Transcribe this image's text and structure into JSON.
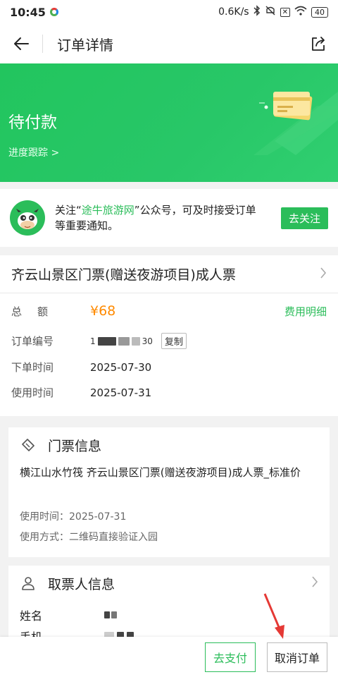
{
  "status_bar": {
    "time": "10:45",
    "network_speed": "0.6K/s",
    "battery": "40"
  },
  "header": {
    "title": "订单详情"
  },
  "banner": {
    "status": "待付款",
    "track_link": "进度跟踪 >",
    "bg_color": "#28c768"
  },
  "follow": {
    "text_before": "关注“",
    "brand": "途牛旅游网",
    "text_after": "”公众号，可及时接受订单等重要通知。",
    "button": "去关注"
  },
  "product": {
    "name": "齐云山景区门票(赠送夜游项目)成人票"
  },
  "order": {
    "total_label": "总额",
    "total_value": "¥68",
    "fee_detail": "费用明细",
    "number_label": "订单编号",
    "number_value_left": "1",
    "number_value_right": "30",
    "copy": "复制",
    "order_time_label": "下单时间",
    "order_time_value": "2025-07-30",
    "use_time_label": "使用时间",
    "use_time_value": "2025-07-31"
  },
  "ticket": {
    "title": "门票信息",
    "name": "横江山水竹筏 齐云山景区门票(赠送夜游项目)成人票_标准价",
    "use_time": "使用时间：2025-07-31",
    "use_method": "使用方式：二维码直接验证入园"
  },
  "holder": {
    "title": "取票人信息",
    "name_label": "姓名",
    "phone_label": "手机"
  },
  "bottom": {
    "pay": "去支付",
    "cancel": "取消订单"
  },
  "colors": {
    "accent": "#2bbd5a",
    "price": "#ff8a00",
    "annotation_arrow": "#e53935"
  }
}
